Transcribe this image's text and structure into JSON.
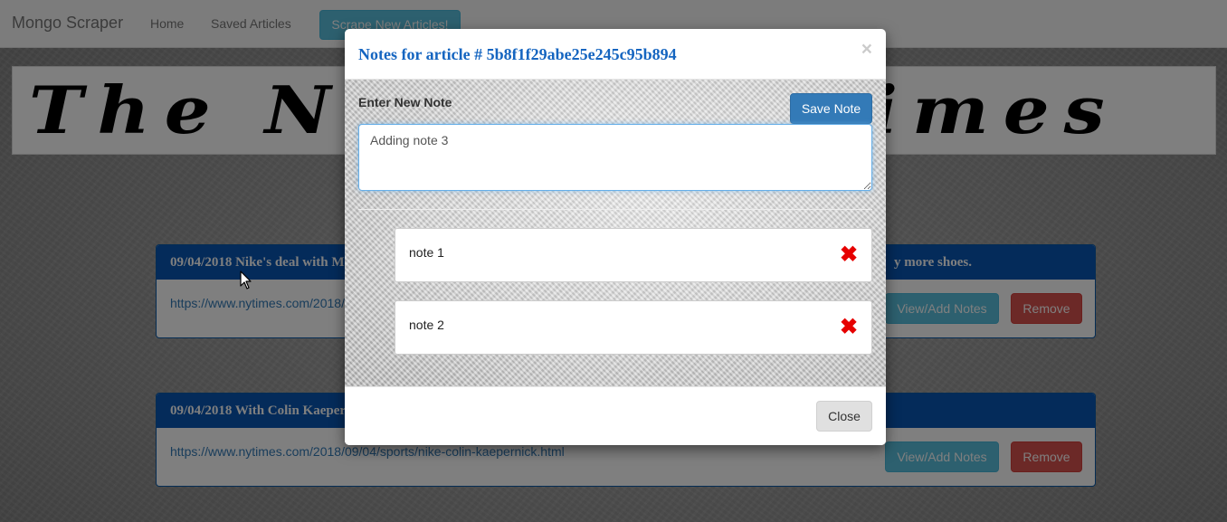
{
  "navbar": {
    "brand": "Mongo Scraper",
    "links": [
      "Home",
      "Saved Articles"
    ],
    "scrape_button": "Scrape New Articles!"
  },
  "masthead": {
    "title": "The New York Times"
  },
  "articles": [
    {
      "heading_start": "09/04/2018 Nike's deal with M",
      "heading_end": "y more shoes.",
      "link": "https://www.nytimes.com/2018/",
      "notes_button": "View/Add Notes",
      "remove_button": "Remove"
    },
    {
      "heading_start": "09/04/2018 With Colin Kaeper",
      "heading_end": "",
      "link": "https://www.nytimes.com/2018/09/04/sports/nike-colin-kaepernick.html",
      "notes_button": "View/Add Notes",
      "remove_button": "Remove"
    }
  ],
  "modal": {
    "title": "Notes for article # 5b8f1f29abe25e245c95b894",
    "close_x": "×",
    "note_label": "Enter New Note",
    "save_button": "Save Note",
    "input_value": "Adding note 3",
    "notes": [
      {
        "text": "note 1",
        "delete_icon": "✖"
      },
      {
        "text": "note 2",
        "delete_icon": "✖"
      }
    ],
    "close_button": "Close"
  },
  "colors": {
    "panel_heading": "#0857b4",
    "primary_button": "#337ab7",
    "info_button": "#5bc0de",
    "danger_button": "#d9534f",
    "delete_icon": "#e60000",
    "modal_title": "#1565c0"
  }
}
